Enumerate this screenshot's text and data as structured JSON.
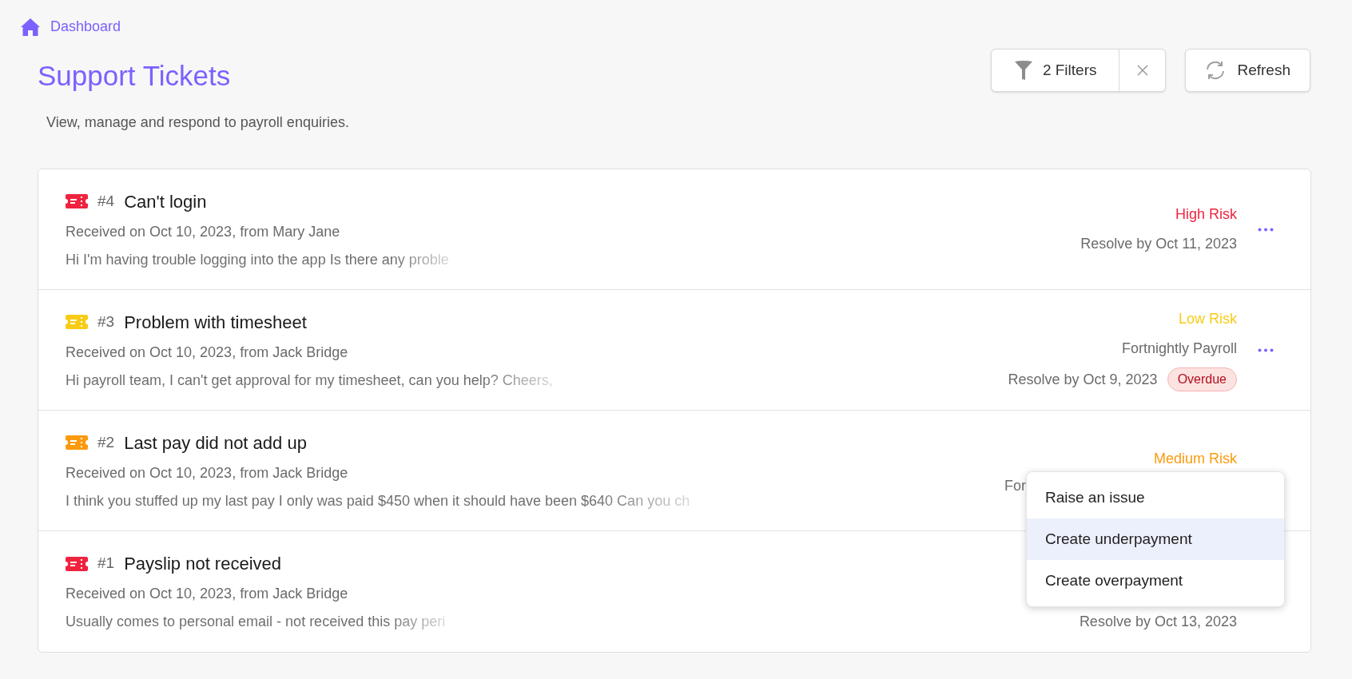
{
  "breadcrumb": {
    "label": "Dashboard"
  },
  "page": {
    "title": "Support Tickets",
    "subtitle": "View, manage and respond to payroll enquiries."
  },
  "toolbar": {
    "filters_label": "2 Filters",
    "refresh_label": "Refresh"
  },
  "tickets": [
    {
      "number": "#4",
      "title": "Can't login",
      "received": "Received on Oct 10, 2023, from Mary Jane",
      "preview": "Hi I'm having trouble logging into the app Is there any proble",
      "risk": "High Risk",
      "color": "#f0233f",
      "resolve": "Resolve by Oct 11, 2023",
      "covered_by_menu": false
    },
    {
      "number": "#3",
      "title": "Problem with timesheet",
      "received": "Received on Oct 10, 2023, from Jack Bridge",
      "preview": "Hi payroll team, I can't get approval for my timesheet, can you help? Cheers,",
      "risk": "Low Risk",
      "color": "#f8cc16",
      "category": "Fortnightly Payroll",
      "resolve": "Resolve by Oct 9, 2023",
      "badge": "Overdue",
      "covered_by_menu": false
    },
    {
      "number": "#2",
      "title": "Last pay did not add up",
      "received": "Received on Oct 10, 2023, from Jack Bridge",
      "preview": "I think you stuffed up my last pay  I only was paid $450 when it should have been $640 Can you ch",
      "risk": "Medium Risk",
      "color": "#fb9a0e",
      "category": "For",
      "covered_by_menu": true
    },
    {
      "number": "#1",
      "title": "Payslip not received",
      "received": "Received on Oct 10, 2023, from Jack Bridge",
      "preview": "Usually comes to personal email - not received this pay peri",
      "color": "#f0233f",
      "resolve": "Resolve by Oct 13, 2023",
      "covered_by_menu": true
    }
  ],
  "menu": [
    {
      "label": "Raise an issue",
      "highlighted": false
    },
    {
      "label": "Create underpayment",
      "highlighted": true
    },
    {
      "label": "Create overpayment",
      "highlighted": false
    }
  ]
}
